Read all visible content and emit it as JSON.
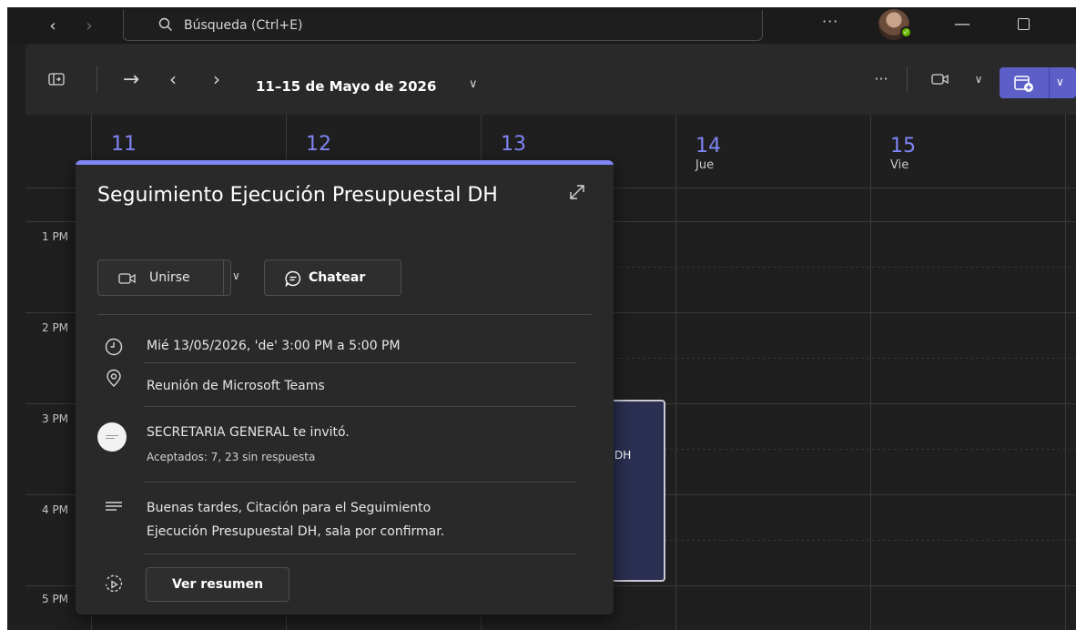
{
  "search": {
    "placeholder": "Búsqueda (Ctrl+E)"
  },
  "toolbar": {
    "date_range": "11–15 de Mayo de 2026"
  },
  "days": [
    {
      "num": "11",
      "name": ""
    },
    {
      "num": "12",
      "name": ""
    },
    {
      "num": "13",
      "name": ""
    },
    {
      "num": "14",
      "name": "Jue"
    },
    {
      "num": "15",
      "name": "Vie"
    }
  ],
  "hours": [
    "1 PM",
    "2 PM",
    "3 PM",
    "4 PM",
    "5 PM"
  ],
  "event_partial_text": "DH",
  "popup": {
    "title": "Seguimiento Ejecución Presupuestal DH",
    "join_label": "Unirse",
    "chat_label": "Chatear",
    "datetime": "Mié 13/05/2026, 'de' 3:00 PM a 5:00 PM",
    "location": "Reunión de Microsoft Teams",
    "organizer": "SECRETARIA GENERAL te invitó.",
    "responses": "Aceptados: 7, 23 sin respuesta",
    "description_line1": "Buenas tardes, Citación para el Seguimiento",
    "description_line2": "Ejecución Presupuestal DH, sala por confirmar.",
    "summary_label": "Ver resumen"
  },
  "colors": {
    "accent": "#7f85f5",
    "primary_button": "#5b5fc7",
    "presence": "#6bb700"
  }
}
